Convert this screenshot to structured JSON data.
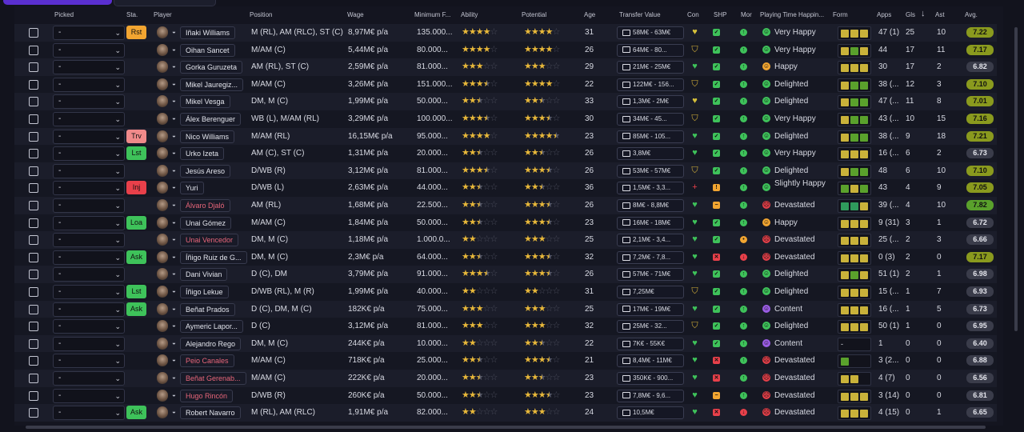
{
  "columns": {
    "picked": "Picked",
    "status": "Sta.",
    "player": "Player",
    "position": "Position",
    "wage": "Wage",
    "min_fee": "Minimum F...",
    "ability": "Ability",
    "potential": "Potential",
    "age": "Age",
    "transfer_value": "Transfer Value",
    "con": "Con",
    "shp": "SHP",
    "mor": "Mor",
    "playing_time": "Playing Time Happin...",
    "form": "Form",
    "apps": "Apps",
    "gls": "Gls",
    "sort_indicator": "↓",
    "ast": "Ast",
    "avg": "Avg."
  },
  "colors": {
    "bg": "#12131d",
    "row_odd": "#1b1d2a",
    "row_even": "#151722",
    "star": "#e8b83a",
    "green": "#3ec25a",
    "orange": "#f2a531",
    "red": "#e8404a",
    "purple": "#9b5de5"
  },
  "rows": [
    {
      "picked": "-",
      "status": "Rst",
      "status_color": "#f2a531",
      "name": "Iñaki Williams",
      "red": false,
      "position": "M (RL), AM (RLC), ST (C)",
      "wage": "8,97M€ p/a",
      "fee": "135.000...",
      "ability": 4,
      "potential": 4,
      "age": "31",
      "tv": "58M€ - 63M€",
      "con": "heart",
      "con_color": "#d6c03a",
      "shp": "check",
      "shp_color": "#3ec25a",
      "mor": "up",
      "mor_color": "#3ec25a",
      "pt_face": "happy",
      "pt_color": "#3ec25a",
      "pt": "Very Happy",
      "form": [
        "#c9b23a",
        "#c9b23a",
        "#c9b23a"
      ],
      "apps": "47 (1)",
      "gls": "25",
      "ast": "10",
      "avg": "7.22",
      "avg_color": "#8a9a1e"
    },
    {
      "picked": "-",
      "status": "",
      "status_color": "",
      "name": "Oihan Sancet",
      "red": false,
      "position": "M/AM (C)",
      "wage": "5,44M€ p/a",
      "fee": "80.000...",
      "ability": 4,
      "potential": 4,
      "age": "26",
      "tv": "64M€ - 80...",
      "con": "shield",
      "con_color": "#d6b23a",
      "shp": "check",
      "shp_color": "#3ec25a",
      "mor": "up",
      "mor_color": "#3ec25a",
      "pt_face": "happy",
      "pt_color": "#3ec25a",
      "pt": "Very Happy",
      "form": [
        "#c9b23a",
        "#5aa12c",
        "#c9b23a"
      ],
      "apps": "44",
      "gls": "17",
      "ast": "11",
      "avg": "7.17",
      "avg_color": "#8a9a1e"
    },
    {
      "picked": "-",
      "status": "",
      "status_color": "",
      "name": "Gorka Guruzeta",
      "red": false,
      "position": "AM (RL), ST (C)",
      "wage": "2,59M€ p/a",
      "fee": "81.000...",
      "ability": 3,
      "potential": 3,
      "age": "29",
      "tv": "21M€ - 25M€",
      "con": "heart",
      "con_color": "#3ec25a",
      "shp": "check",
      "shp_color": "#3ec25a",
      "mor": "up",
      "mor_color": "#3ec25a",
      "pt_face": "smile",
      "pt_color": "#f2a531",
      "pt": "Happy",
      "form": [
        "#c9b23a",
        "#c9b23a",
        "#c9b23a"
      ],
      "apps": "30",
      "gls": "17",
      "ast": "2",
      "avg": "6.82",
      "avg_color": "#3a3c4a"
    },
    {
      "picked": "-",
      "status": "",
      "status_color": "",
      "name": "Mikel Jauregiz...",
      "red": false,
      "position": "M/AM (C)",
      "wage": "3,26M€ p/a",
      "fee": "151.000...",
      "ability": 3.5,
      "potential": 4,
      "age": "22",
      "tv": "122M€ - 156...",
      "con": "shield",
      "con_color": "#d6b23a",
      "shp": "check",
      "shp_color": "#3ec25a",
      "mor": "up",
      "mor_color": "#3ec25a",
      "pt_face": "happy",
      "pt_color": "#3ec25a",
      "pt": "Delighted",
      "form": [
        "#c9b23a",
        "#5aa12c",
        "#5aa12c"
      ],
      "apps": "38 (...",
      "gls": "12",
      "ast": "3",
      "avg": "7.10",
      "avg_color": "#8a9a1e"
    },
    {
      "picked": "-",
      "status": "",
      "status_color": "",
      "name": "Mikel Vesga",
      "red": false,
      "position": "DM, M (C)",
      "wage": "1,99M€ p/a",
      "fee": "50.000...",
      "ability": 2.5,
      "potential": 2.5,
      "age": "33",
      "tv": "1,3M€ - 2M€",
      "con": "heart",
      "con_color": "#d6c03a",
      "shp": "check",
      "shp_color": "#3ec25a",
      "mor": "up",
      "mor_color": "#3ec25a",
      "pt_face": "happy",
      "pt_color": "#3ec25a",
      "pt": "Delighted",
      "form": [
        "#c9b23a",
        "#5aa12c",
        "#5aa12c"
      ],
      "apps": "47 (...",
      "gls": "11",
      "ast": "8",
      "avg": "7.01",
      "avg_color": "#8a9a1e"
    },
    {
      "picked": "-",
      "status": "",
      "status_color": "",
      "name": "Álex Berenguer",
      "red": false,
      "position": "WB (L), M/AM (RL)",
      "wage": "3,29M€ p/a",
      "fee": "100.000...",
      "ability": 3.5,
      "potential": 3.5,
      "age": "30",
      "tv": "34M€ - 45...",
      "con": "shield",
      "con_color": "#d6b23a",
      "shp": "check",
      "shp_color": "#3ec25a",
      "mor": "up",
      "mor_color": "#3ec25a",
      "pt_face": "happy",
      "pt_color": "#3ec25a",
      "pt": "Very Happy",
      "form": [
        "#c9b23a",
        "#5aa12c",
        "#5aa12c"
      ],
      "apps": "43 (...",
      "gls": "10",
      "ast": "15",
      "avg": "7.16",
      "avg_color": "#8a9a1e"
    },
    {
      "picked": "-",
      "status": "Trv",
      "status_color": "#f08a8a",
      "name": "Nico Williams",
      "red": false,
      "position": "M/AM (RL)",
      "wage": "16,15M€ p/a",
      "fee": "95.000...",
      "ability": 4,
      "potential": 4.5,
      "age": "23",
      "tv": "85M€ - 105...",
      "con": "heart",
      "con_color": "#3ec25a",
      "shp": "check",
      "shp_color": "#3ec25a",
      "mor": "up",
      "mor_color": "#3ec25a",
      "pt_face": "happy",
      "pt_color": "#3ec25a",
      "pt": "Delighted",
      "form": [
        "#c9b23a",
        "#5aa12c",
        "#5aa12c"
      ],
      "apps": "38 (...",
      "gls": "9",
      "ast": "18",
      "avg": "7.21",
      "avg_color": "#8a9a1e"
    },
    {
      "picked": "-",
      "status": "Lst",
      "status_color": "#3ec25a",
      "name": "Urko Izeta",
      "red": false,
      "position": "AM (C), ST (C)",
      "wage": "1,31M€ p/a",
      "fee": "20.000...",
      "ability": 2.5,
      "potential": 2.5,
      "age": "26",
      "tv": "3,8M€",
      "con": "heart",
      "con_color": "#3ec25a",
      "shp": "check",
      "shp_color": "#3ec25a",
      "mor": "up",
      "mor_color": "#3ec25a",
      "pt_face": "happy",
      "pt_color": "#3ec25a",
      "pt": "Very Happy",
      "form": [
        "#c9b23a",
        "#c9b23a",
        "#c9b23a"
      ],
      "apps": "16 (...",
      "gls": "6",
      "ast": "2",
      "avg": "6.73",
      "avg_color": "#3a3c4a"
    },
    {
      "picked": "-",
      "status": "",
      "status_color": "",
      "name": "Jesús Areso",
      "red": false,
      "position": "D/WB (R)",
      "wage": "3,12M€ p/a",
      "fee": "81.000...",
      "ability": 3.5,
      "potential": 3.5,
      "age": "26",
      "tv": "53M€ - 57M€",
      "con": "shield",
      "con_color": "#d6b23a",
      "shp": "check",
      "shp_color": "#3ec25a",
      "mor": "up",
      "mor_color": "#3ec25a",
      "pt_face": "happy",
      "pt_color": "#3ec25a",
      "pt": "Delighted",
      "form": [
        "#c9b23a",
        "#5aa12c",
        "#5aa12c"
      ],
      "apps": "48",
      "gls": "6",
      "ast": "10",
      "avg": "7.10",
      "avg_color": "#8a9a1e"
    },
    {
      "picked": "-",
      "status": "Inj",
      "status_color": "#e8404a",
      "name": "Yuri",
      "red": false,
      "position": "D/WB (L)",
      "wage": "2,63M€ p/a",
      "fee": "44.000...",
      "ability": 2.5,
      "potential": 2.5,
      "age": "36",
      "tv": "1,5M€ - 3,3...",
      "con": "plus",
      "con_color": "#e8404a",
      "shp": "warn",
      "shp_color": "#f2a531",
      "mor": "up",
      "mor_color": "#3ec25a",
      "pt_face": "smile",
      "pt_color": "#3ec25a",
      "pt": "Slightly Happy",
      "form": [
        "#5aa12c",
        "#c9b23a",
        "#5aa12c"
      ],
      "apps": "43",
      "gls": "4",
      "ast": "9",
      "avg": "7.05",
      "avg_color": "#8a9a1e"
    },
    {
      "picked": "-",
      "status": "",
      "status_color": "",
      "name": "Álvaro Djaló",
      "red": true,
      "position": "AM (RL)",
      "wage": "1,68M€ p/a",
      "fee": "22.500...",
      "ability": 2.5,
      "potential": 3.5,
      "age": "26",
      "tv": "8M€ - 8,8M€",
      "con": "heart",
      "con_color": "#3ec25a",
      "shp": "minus",
      "shp_color": "#f2a531",
      "mor": "up",
      "mor_color": "#3ec25a",
      "pt_face": "sad",
      "pt_color": "#e8404a",
      "pt": "Devastated",
      "form": [
        "#2f9a5c",
        "#2f9a5c",
        "#c9b23a"
      ],
      "apps": "39 (...",
      "gls": "4",
      "ast": "10",
      "avg": "7.82",
      "avg_color": "#5aa12c"
    },
    {
      "picked": "-",
      "status": "Loa",
      "status_color": "#3ec25a",
      "name": "Unai Gómez",
      "red": false,
      "position": "M/AM (C)",
      "wage": "1,84M€ p/a",
      "fee": "50.000...",
      "ability": 2.5,
      "potential": 3.5,
      "age": "23",
      "tv": "16M€ - 18M€",
      "con": "heart",
      "con_color": "#3ec25a",
      "shp": "check",
      "shp_color": "#3ec25a",
      "mor": "up",
      "mor_color": "#3ec25a",
      "pt_face": "smile",
      "pt_color": "#f2a531",
      "pt": "Happy",
      "form": [
        "#c9b23a",
        "#c9b23a",
        "#c9b23a"
      ],
      "apps": "9 (31)",
      "gls": "3",
      "ast": "1",
      "avg": "6.72",
      "avg_color": "#3a3c4a"
    },
    {
      "picked": "-",
      "status": "",
      "status_color": "",
      "name": "Unai Vencedor",
      "red": true,
      "position": "DM, M (C)",
      "wage": "1,18M€ p/a",
      "fee": "1.000.0...",
      "ability": 2,
      "potential": 3,
      "age": "25",
      "tv": "2,1M€ - 3,4...",
      "con": "heart",
      "con_color": "#3ec25a",
      "shp": "check",
      "shp_color": "#3ec25a",
      "mor": "dot",
      "mor_color": "#f2a531",
      "pt_face": "sad",
      "pt_color": "#e8404a",
      "pt": "Devastated",
      "form": [
        "#c9b23a",
        "#c9b23a",
        "#c9b23a"
      ],
      "apps": "25 (...",
      "gls": "2",
      "ast": "3",
      "avg": "6.66",
      "avg_color": "#3a3c4a"
    },
    {
      "picked": "-",
      "status": "Ask",
      "status_color": "#3ec25a",
      "name": "Íñigo Ruiz de G...",
      "red": false,
      "position": "DM, M (C)",
      "wage": "2,3M€ p/a",
      "fee": "64.000...",
      "ability": 2.5,
      "potential": 3.5,
      "age": "32",
      "tv": "7,2M€ - 7,8...",
      "con": "heart",
      "con_color": "#3ec25a",
      "shp": "cross",
      "shp_color": "#e8404a",
      "mor": "down",
      "mor_color": "#e8404a",
      "pt_face": "sad",
      "pt_color": "#e8404a",
      "pt": "Devastated",
      "form": [
        "#c9b23a",
        "#c9b23a",
        "#c9b23a"
      ],
      "apps": "0 (3)",
      "gls": "2",
      "ast": "0",
      "avg": "7.17",
      "avg_color": "#8a9a1e"
    },
    {
      "picked": "-",
      "status": "",
      "status_color": "",
      "name": "Dani Vivian",
      "red": false,
      "position": "D (C), DM",
      "wage": "3,79M€ p/a",
      "fee": "91.000...",
      "ability": 3.5,
      "potential": 3.5,
      "age": "26",
      "tv": "57M€ - 71M€",
      "con": "heart",
      "con_color": "#3ec25a",
      "shp": "check",
      "shp_color": "#3ec25a",
      "mor": "up",
      "mor_color": "#3ec25a",
      "pt_face": "happy",
      "pt_color": "#3ec25a",
      "pt": "Delighted",
      "form": [
        "#c9b23a",
        "#5aa12c",
        "#c9b23a"
      ],
      "apps": "51 (1)",
      "gls": "2",
      "ast": "1",
      "avg": "6.98",
      "avg_color": "#3a3c4a"
    },
    {
      "picked": "-",
      "status": "Lst",
      "status_color": "#3ec25a",
      "name": "Íñigo Lekue",
      "red": false,
      "position": "D/WB (RL), M (R)",
      "wage": "1,99M€ p/a",
      "fee": "40.000...",
      "ability": 2,
      "potential": 2,
      "age": "31",
      "tv": "7,25M€",
      "con": "shield",
      "con_color": "#d6b23a",
      "shp": "check",
      "shp_color": "#3ec25a",
      "mor": "up",
      "mor_color": "#3ec25a",
      "pt_face": "happy",
      "pt_color": "#3ec25a",
      "pt": "Delighted",
      "form": [
        "#c9b23a",
        "#c9b23a",
        "#c9b23a"
      ],
      "apps": "15 (...",
      "gls": "1",
      "ast": "7",
      "avg": "6.93",
      "avg_color": "#3a3c4a"
    },
    {
      "picked": "-",
      "status": "Ask",
      "status_color": "#3ec25a",
      "name": "Beñat Prados",
      "red": false,
      "position": "D (C), DM, M (C)",
      "wage": "182K€ p/a",
      "fee": "75.000...",
      "ability": 3,
      "potential": 3,
      "age": "25",
      "tv": "17M€ - 19M€",
      "con": "heart",
      "con_color": "#3ec25a",
      "shp": "check",
      "shp_color": "#3ec25a",
      "mor": "up",
      "mor_color": "#3ec25a",
      "pt_face": "neutral",
      "pt_color": "#9b5de5",
      "pt": "Content",
      "form": [
        "#c9b23a",
        "#c9b23a",
        "#c9b23a"
      ],
      "apps": "16 (...",
      "gls": "1",
      "ast": "5",
      "avg": "6.73",
      "avg_color": "#3a3c4a"
    },
    {
      "picked": "-",
      "status": "",
      "status_color": "",
      "name": "Aymeric Lapor...",
      "red": false,
      "position": "D (C)",
      "wage": "3,12M€ p/a",
      "fee": "81.000...",
      "ability": 3,
      "potential": 3,
      "age": "32",
      "tv": "25M€ - 32...",
      "con": "shield",
      "con_color": "#d6b23a",
      "shp": "check",
      "shp_color": "#3ec25a",
      "mor": "up",
      "mor_color": "#3ec25a",
      "pt_face": "happy",
      "pt_color": "#3ec25a",
      "pt": "Delighted",
      "form": [
        "#c9b23a",
        "#c9b23a",
        "#c9b23a"
      ],
      "apps": "50 (1)",
      "gls": "1",
      "ast": "0",
      "avg": "6.95",
      "avg_color": "#3a3c4a"
    },
    {
      "picked": "-",
      "status": "",
      "status_color": "",
      "name": "Alejandro Rego",
      "red": false,
      "position": "DM, M (C)",
      "wage": "244K€ p/a",
      "fee": "10.000...",
      "ability": 2,
      "potential": 2.5,
      "age": "22",
      "tv": "7K€ - 55K€",
      "con": "heart",
      "con_color": "#3ec25a",
      "shp": "check",
      "shp_color": "#3ec25a",
      "mor": "up",
      "mor_color": "#3ec25a",
      "pt_face": "neutral",
      "pt_color": "#9b5de5",
      "pt": "Content",
      "form": [],
      "apps": "1",
      "gls": "0",
      "ast": "0",
      "avg": "6.40",
      "avg_color": "#3a3c4a"
    },
    {
      "picked": "-",
      "status": "",
      "status_color": "",
      "name": "Peio Canales",
      "red": true,
      "position": "M/AM (C)",
      "wage": "718K€ p/a",
      "fee": "25.000...",
      "ability": 2.5,
      "potential": 3.5,
      "age": "21",
      "tv": "8,4M€ - 11M€",
      "con": "heart",
      "con_color": "#3ec25a",
      "shp": "cross",
      "shp_color": "#e8404a",
      "mor": "up",
      "mor_color": "#3ec25a",
      "pt_face": "sad",
      "pt_color": "#e8404a",
      "pt": "Devastated",
      "form": [
        "#5aa12c"
      ],
      "apps": "3 (2...",
      "gls": "0",
      "ast": "0",
      "avg": "6.88",
      "avg_color": "#3a3c4a"
    },
    {
      "picked": "-",
      "status": "",
      "status_color": "",
      "name": "Beñat Gerenab...",
      "red": true,
      "position": "M/AM (C)",
      "wage": "222K€ p/a",
      "fee": "20.000...",
      "ability": 2.5,
      "potential": 2.5,
      "age": "23",
      "tv": "350K€ - 900...",
      "con": "heart",
      "con_color": "#3ec25a",
      "shp": "cross",
      "shp_color": "#e8404a",
      "mor": "up",
      "mor_color": "#3ec25a",
      "pt_face": "sad",
      "pt_color": "#e8404a",
      "pt": "Devastated",
      "form": [
        "#c9b23a",
        "#c9b23a"
      ],
      "apps": "4 (7)",
      "gls": "0",
      "ast": "0",
      "avg": "6.56",
      "avg_color": "#3a3c4a"
    },
    {
      "picked": "-",
      "status": "",
      "status_color": "",
      "name": "Hugo Rincón",
      "red": true,
      "position": "D/WB (R)",
      "wage": "260K€ p/a",
      "fee": "50.000...",
      "ability": 2.5,
      "potential": 3.5,
      "age": "23",
      "tv": "7,8M€ - 9,6...",
      "con": "heart",
      "con_color": "#3ec25a",
      "shp": "minus",
      "shp_color": "#f2a531",
      "mor": "up",
      "mor_color": "#3ec25a",
      "pt_face": "sad",
      "pt_color": "#e8404a",
      "pt": "Devastated",
      "form": [
        "#c9b23a",
        "#c9b23a",
        "#c9b23a"
      ],
      "apps": "3 (14)",
      "gls": "0",
      "ast": "0",
      "avg": "6.81",
      "avg_color": "#3a3c4a"
    },
    {
      "picked": "-",
      "status": "Ask",
      "status_color": "#3ec25a",
      "name": "Robert Navarro",
      "red": false,
      "position": "M (RL), AM (RLC)",
      "wage": "1,91M€ p/a",
      "fee": "82.000...",
      "ability": 2,
      "potential": 3,
      "age": "24",
      "tv": "10,5M€",
      "con": "heart",
      "con_color": "#3ec25a",
      "shp": "cross",
      "shp_color": "#e8404a",
      "mor": "down",
      "mor_color": "#e8404a",
      "pt_face": "sad",
      "pt_color": "#e8404a",
      "pt": "Devastated",
      "form": [
        "#c9b23a",
        "#c9b23a",
        "#c9b23a"
      ],
      "apps": "4 (15)",
      "gls": "0",
      "ast": "1",
      "avg": "6.65",
      "avg_color": "#3a3c4a"
    }
  ]
}
